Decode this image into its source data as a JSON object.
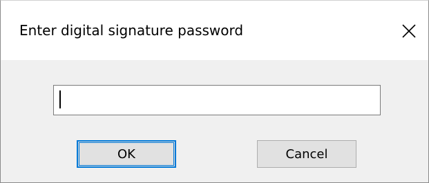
{
  "dialog": {
    "title": "Enter digital signature password",
    "close_icon": "close-icon",
    "password_value": "",
    "ok_label": "OK",
    "cancel_label": "Cancel"
  },
  "colors": {
    "titlebar": "#ffffff",
    "body": "#f0f0f0",
    "button_face": "#e1e1e1",
    "default_button_border": "#0078d7"
  }
}
